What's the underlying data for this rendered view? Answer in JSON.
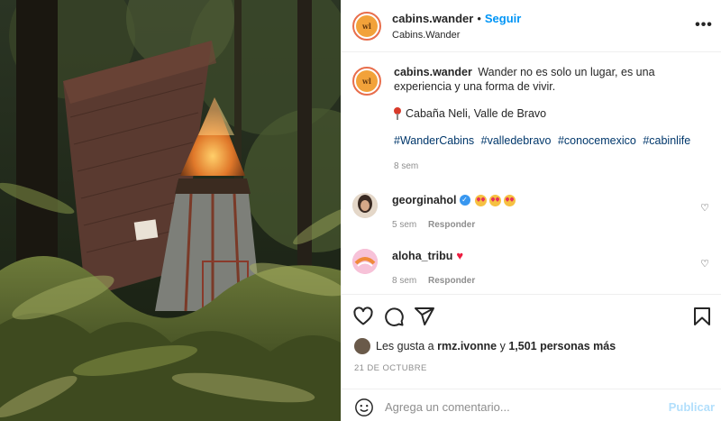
{
  "post": {
    "username": "cabins.wander",
    "avatar_text": "wl",
    "follow_label": "Seguir",
    "separator": "•",
    "subtitle": "Cabins.Wander",
    "more_label": "•••"
  },
  "caption": {
    "username": "cabins.wander",
    "text": "Wander no es solo un lugar, es una experiencia y una forma de vivir.",
    "location": "Cabaña Neli, Valle de Bravo",
    "hashtags": [
      "#WanderCabins",
      "#valledebravo",
      "#conocemexico",
      "#cabinlife"
    ],
    "time": "8 sem"
  },
  "comments": [
    {
      "username": "georginahol",
      "verified": true,
      "time": "5 sem",
      "reply": "Responder"
    },
    {
      "username": "aloha_tribu",
      "verified": false,
      "time": "8 sem",
      "reply": "Responder"
    }
  ],
  "likes": {
    "prefix": "Les gusta a",
    "user": "rmz.ivonne",
    "connector": "y",
    "others": "1,501 personas más"
  },
  "date": "21 DE OCTUBRE",
  "composer": {
    "placeholder": "Agrega un comentario...",
    "publish_label": "Publicar"
  },
  "colors": {
    "link": "#0095f6",
    "hashtag": "#00376b",
    "muted": "#8e8e8e",
    "publish_disabled": "#b2dffc",
    "heart": "#ed1c3f",
    "brand_avatar": "#f2a23a"
  },
  "icons": {
    "like": "heart-outline-icon",
    "comment": "speech-bubble-icon",
    "share": "paper-plane-icon",
    "save": "bookmark-icon",
    "emoji": "smiley-icon",
    "more": "ellipsis-icon"
  }
}
